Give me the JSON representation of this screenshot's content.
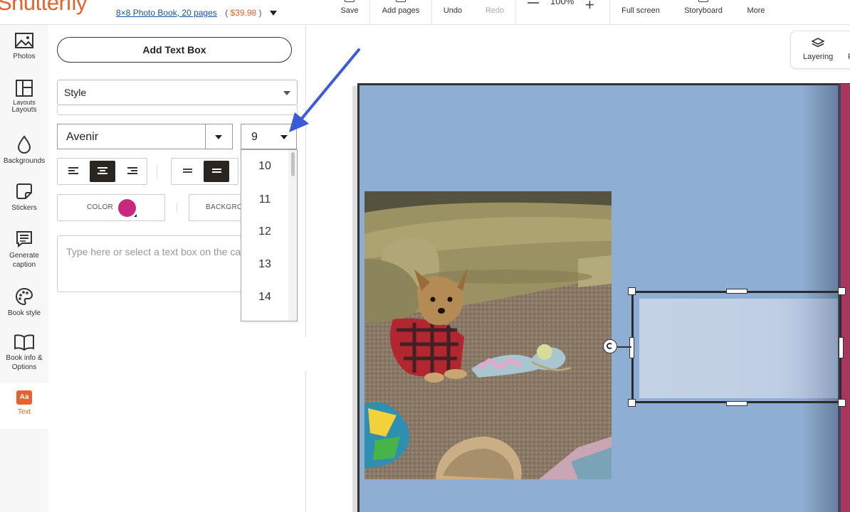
{
  "brand": {
    "name": "Shutterfly",
    "color": "#e8612c"
  },
  "book": {
    "title": "8×8 Photo Book, 20 pages",
    "price_open": "(",
    "price": "$39.98",
    "price_close": ")"
  },
  "toolbar": {
    "save": "Save",
    "add_pages": "Add pages",
    "undo": "Undo",
    "redo": "Redo",
    "zoom": "100%",
    "full_screen": "Full screen",
    "storyboard": "Storyboard",
    "more": "More"
  },
  "rail": {
    "photos": "Photos",
    "layouts_a": "Layouts",
    "layouts_b": "Layouts",
    "backgrounds": "Backgrounds",
    "stickers": "Stickers",
    "caption_a": "Generate",
    "caption_b": "caption",
    "book_style": "Book style",
    "info_a": "Book info &",
    "info_b": "Options",
    "text": "Text",
    "text_icon": "Aa"
  },
  "panel": {
    "add_text_box": "Add Text Box",
    "style_label": "Style",
    "font": "Avenir",
    "font_size": "9",
    "color_label": "COLOR",
    "color_swatch": "#c8297f",
    "background_label": "BACKGROUND",
    "text_placeholder": "Type here or select a text box on the canvas"
  },
  "font_size_options": [
    "10",
    "11",
    "12",
    "13",
    "14"
  ],
  "canvas": {
    "layering": "Layering",
    "layering_next": "F"
  },
  "colors": {
    "page": "#8faed3",
    "spine": "#a8365e",
    "accent_arrow": "#3b5bdb"
  }
}
